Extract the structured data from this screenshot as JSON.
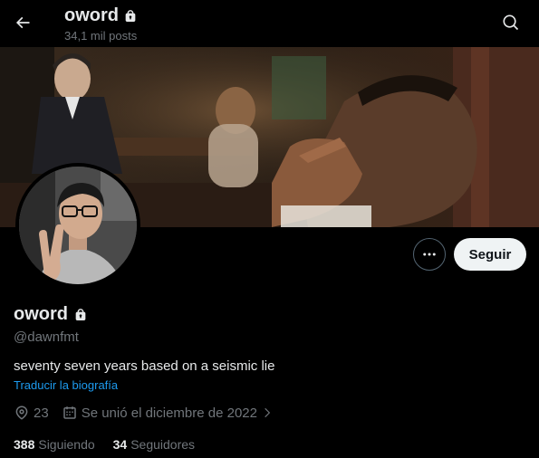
{
  "header": {
    "title": "oword",
    "post_count": "34,1 mil posts",
    "back_icon": "arrow-left-icon",
    "lock_icon": "lock-icon",
    "search_icon": "search-icon"
  },
  "profile": {
    "name": "oword",
    "handle": "@dawnfmt",
    "bio": "seventy seven years based on a seismic lie",
    "translate_label": "Traducir la biografía",
    "location": "23",
    "joined": "Se unió el diciembre de 2022",
    "following_count": "388",
    "following_label": "Siguiendo",
    "followers_count": "34",
    "followers_label": "Seguidores"
  },
  "actions": {
    "follow_label": "Seguir",
    "more_icon": "more-horizontal-icon"
  },
  "colors": {
    "background": "#000000",
    "text_primary": "#e7e9ea",
    "text_secondary": "#71767b",
    "link": "#1d9bf0",
    "follow_button_bg": "#eff3f4"
  }
}
